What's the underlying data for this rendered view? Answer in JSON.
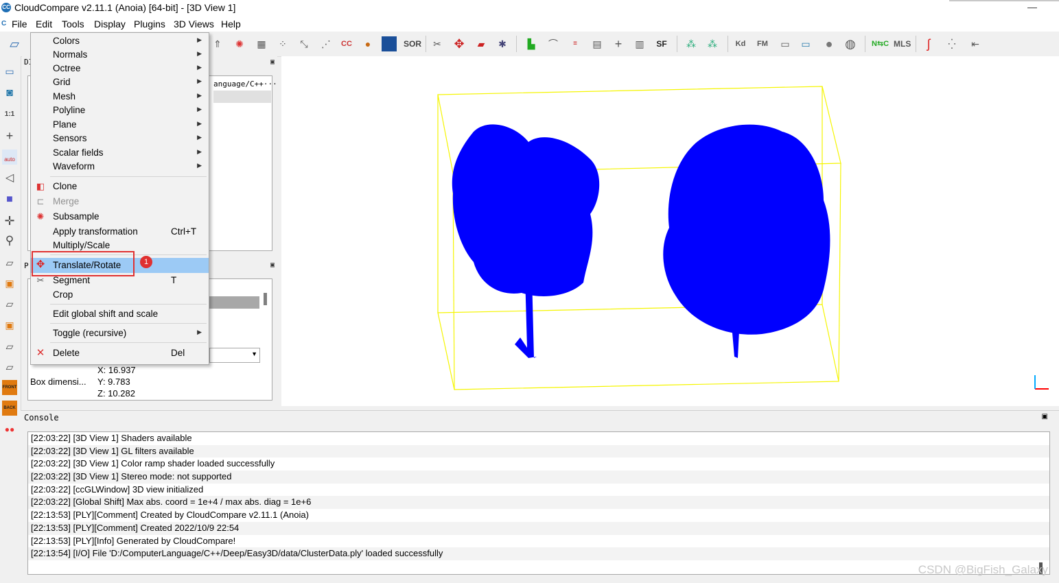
{
  "window": {
    "title": "CloudCompare v2.11.1 (Anoia) [64-bit] - [3D View 1]",
    "app_icon_text": "CC",
    "minimize_glyph": "—"
  },
  "menubar": {
    "items": [
      "File",
      "Edit",
      "Tools",
      "Display",
      "Plugins",
      "3D Views",
      "Help"
    ]
  },
  "edit_menu": {
    "submenus": [
      "Colors",
      "Normals",
      "Octree",
      "Grid",
      "Mesh",
      "Polyline",
      "Plane",
      "Sensors",
      "Scalar fields",
      "Waveform"
    ],
    "actions": [
      {
        "label": "Clone",
        "icon": "clone-icon"
      },
      {
        "label": "Merge",
        "icon": "merge-icon",
        "disabled": true
      },
      {
        "label": "Subsample",
        "icon": "subsample-icon"
      },
      {
        "label": "Apply transformation",
        "shortcut": "Ctrl+T"
      },
      {
        "label": "Multiply/Scale"
      },
      {
        "label": "Translate/Rotate",
        "icon": "translate-rotate-icon",
        "highlighted": true
      },
      {
        "label": "Segment",
        "shortcut": "T",
        "icon": "scissors-icon"
      },
      {
        "label": "Crop"
      },
      {
        "label": "Edit global shift and scale"
      },
      {
        "label": "Toggle (recursive)"
      },
      {
        "label": "Delete",
        "shortcut": "Del",
        "icon": "delete-icon"
      }
    ],
    "annotation_badge": "1",
    "highlight_color": "#9ccaf5",
    "annotation_color": "#e03030"
  },
  "toolbar": {
    "labels": {
      "cc": "CC",
      "sor": "SOR",
      "sf": "SF",
      "kd": "Kd",
      "fm": "FM",
      "nc": "N⇆C",
      "mls": "MLS"
    }
  },
  "left_toolbar": {
    "labels": {
      "ratio": "1:1",
      "auto": "auto",
      "front": "FRONT",
      "back": "BACK"
    }
  },
  "db_tree": {
    "header_abbrev": "DI",
    "path_fragment": "anguage/C++···"
  },
  "properties": {
    "header_abbrev": "P",
    "box_label": "Box dimensi...",
    "box_values": [
      "X: 16.937",
      "Y: 9.783",
      "Z: 10.282"
    ]
  },
  "view3d": {
    "point_color": "#0000ff",
    "bbox_color": "#ffff00",
    "axis_colors": [
      "#ff0000",
      "#00aaff"
    ]
  },
  "console": {
    "title": "Console",
    "lines": [
      "[22:03:22] [3D View 1] Shaders available",
      "[22:03:22] [3D View 1] GL filters available",
      "[22:03:22] [3D View 1] Color ramp shader loaded successfully",
      "[22:03:22] [3D View 1] Stereo mode: not supported",
      "[22:03:22] [ccGLWindow] 3D view initialized",
      "[22:03:22] [Global Shift] Max abs. coord = 1e+4 / max abs. diag = 1e+6",
      "[22:13:53] [PLY][Comment] Created by CloudCompare v2.11.1 (Anoia)",
      "[22:13:53] [PLY][Comment] Created 2022/10/9 22:54",
      "[22:13:53] [PLY][Info] Generated by CloudCompare!",
      "[22:13:54] [I/O] File 'D:/ComputerLanguage/C++/Deep/Easy3D/data/ClusterData.ply' loaded successfully"
    ]
  },
  "watermark": "CSDN @BigFish_Galaxy"
}
